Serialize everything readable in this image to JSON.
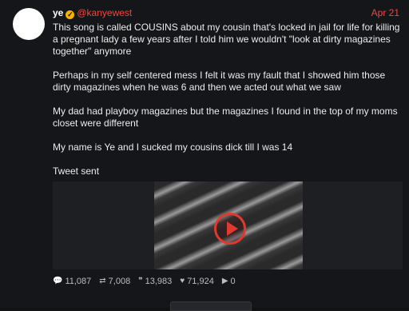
{
  "post": {
    "name": "ye",
    "handle": "@kanyewest",
    "date": "Apr 21",
    "paragraphs": [
      "This song is called COUSINS about my cousin that's locked in jail for life for killing a pregnant lady a few years after I told him we wouldn't \"look at dirty magazines together\" anymore",
      "Perhaps in my self centered mess I felt it was my fault that I showed him those dirty magazines when he was 6 and then we acted out what we saw",
      "My dad had playboy magazines but the magazines I found in the top of my moms closet were different",
      "My name is Ye and I sucked my cousins dick till I was 14",
      "Tweet sent"
    ],
    "stats": {
      "comments": "11,087",
      "reposts": "7,008",
      "quotes": "13,983",
      "likes": "71,924",
      "views": "0"
    },
    "icons": {
      "verified": "verified-badge-icon",
      "comments": "comment-icon",
      "reposts": "repost-icon",
      "quotes": "quote-icon",
      "likes": "heart-icon",
      "views": "play-count-icon"
    },
    "colors": {
      "accent": "#f0483e",
      "background": "#151619",
      "verified": "#f5b400"
    }
  }
}
